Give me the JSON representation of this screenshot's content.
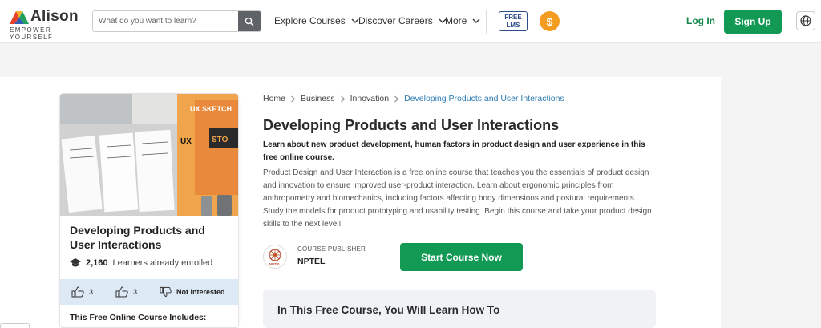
{
  "header": {
    "brand": "Alison",
    "tagline": "EMPOWER YOURSELF",
    "search_placeholder": "What do you want to learn?",
    "nav": [
      "Explore Courses",
      "Discover Careers",
      "More"
    ],
    "free_lms": [
      "FREE",
      "LMS"
    ],
    "coin_symbol": "$",
    "login": "Log In",
    "signup": "Sign Up"
  },
  "card": {
    "title": "Developing Products and User Interactions",
    "learners_count": "2,160",
    "learners_text": "Learners already enrolled",
    "likes": "3",
    "shares": "3",
    "not_interested": "Not Interested",
    "includes": "This Free Online Course Includes:",
    "thumb_text": [
      "UX SKETCH",
      "UX",
      "STO"
    ]
  },
  "breadcrumbs": [
    "Home",
    "Business",
    "Innovation",
    "Developing Products and User Interactions"
  ],
  "course": {
    "title": "Developing Products and User Interactions",
    "lead": "Learn about new product development, human factors in product design and user experience in this free online course.",
    "description": "Product Design and User Interaction is a free online course that teaches you the essentials of product design and innovation to ensure improved user-product interaction. Learn about ergonomic principles from anthropometry and biomechanics, including factors affecting body dimensions and postural requirements. Study the models for product prototyping and usability testing. Begin this course and take your product design skills to the next level!",
    "publisher_label": "COURSE PUBLISHER",
    "publisher_name": "NPTEL",
    "publisher_logo_text": "NPTEL",
    "start_button": "Start Course Now",
    "learn_title": "In This Free Course, You Will Learn How To"
  },
  "colors": {
    "brand_green": "#129a55",
    "link_blue": "#2d7db3",
    "coin_orange": "#f39c1f"
  }
}
